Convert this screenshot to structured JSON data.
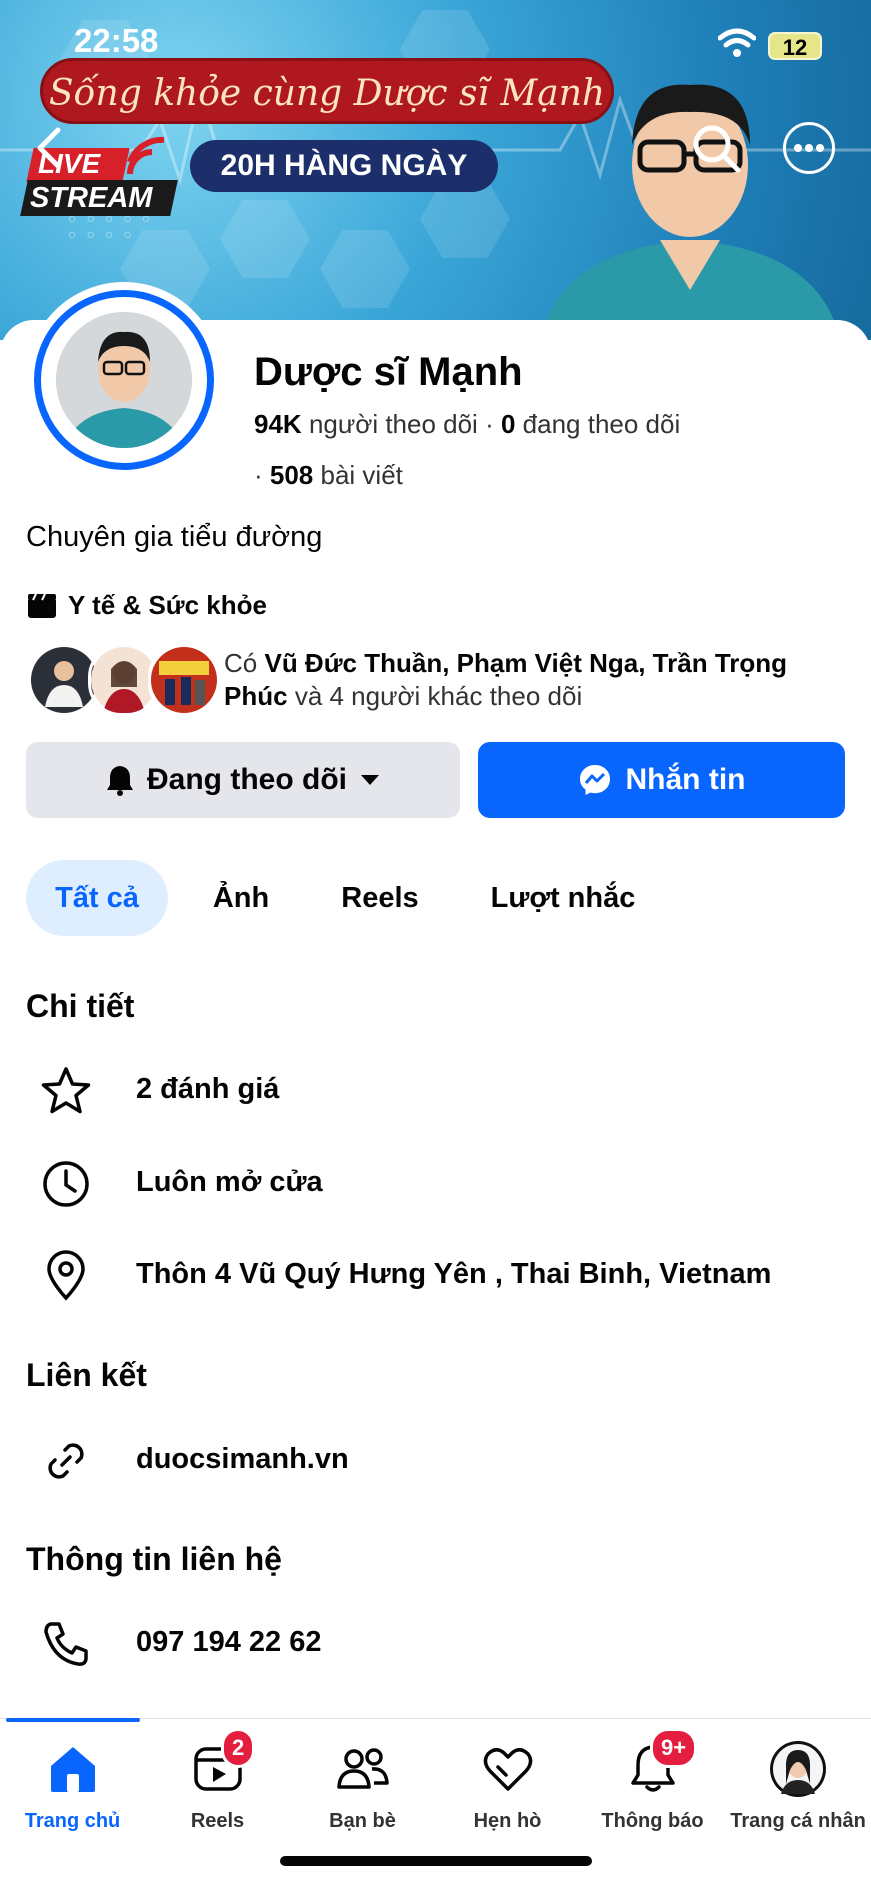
{
  "status_bar": {
    "time": "22:58",
    "battery": "12"
  },
  "cover": {
    "banner": "Sống khỏe cùng Dược sĩ Mạnh",
    "schedule": "20H HÀNG NGÀY",
    "live_line1": "LIVE",
    "live_line2": "STREAM"
  },
  "profile": {
    "name": "Dược sĩ Mạnh",
    "followers_count": "94K",
    "followers_label": "người theo dõi",
    "following_count": "0",
    "following_label": "đang theo dõi",
    "posts_count": "508",
    "posts_label": "bài viết",
    "bio": "Chuyên gia tiểu đường",
    "category": "Y tế & Sức khỏe"
  },
  "mutual": {
    "prefix": "Có",
    "names": "Vũ Đức Thuần, Phạm Việt Nga, Trần Trọng Phúc",
    "suffix": "và 4 người khác theo dõi"
  },
  "actions": {
    "follow": "Đang theo dõi",
    "message": "Nhắn tin"
  },
  "tabs": [
    {
      "label": "Tất cả",
      "active": true
    },
    {
      "label": "Ảnh"
    },
    {
      "label": "Reels"
    },
    {
      "label": "Lượt nhắc"
    }
  ],
  "details": {
    "title": "Chi tiết",
    "rating": "2 đánh giá",
    "hours": "Luôn mở cửa",
    "address": "Thôn 4 Vũ Quý Hưng Yên , Thai Binh, Vietnam"
  },
  "links": {
    "title": "Liên kết",
    "website": "duocsimanh.vn"
  },
  "contact": {
    "title": "Thông tin liên hệ",
    "phone": "097 194 22 62"
  },
  "bottom_nav": [
    {
      "label": "Trang chủ",
      "icon": "home-icon",
      "active": true
    },
    {
      "label": "Reels",
      "icon": "reels-icon",
      "badge": "2"
    },
    {
      "label": "Bạn bè",
      "icon": "friends-icon"
    },
    {
      "label": "Hẹn hò",
      "icon": "heart-icon"
    },
    {
      "label": "Thông báo",
      "icon": "bell-icon",
      "badge": "9+"
    },
    {
      "label": "Trang cá nhân",
      "icon": "profile-avatar"
    }
  ],
  "colors": {
    "accent": "#0866ff",
    "badge": "#e41e3f",
    "secondary_button": "#e4e6eb"
  }
}
